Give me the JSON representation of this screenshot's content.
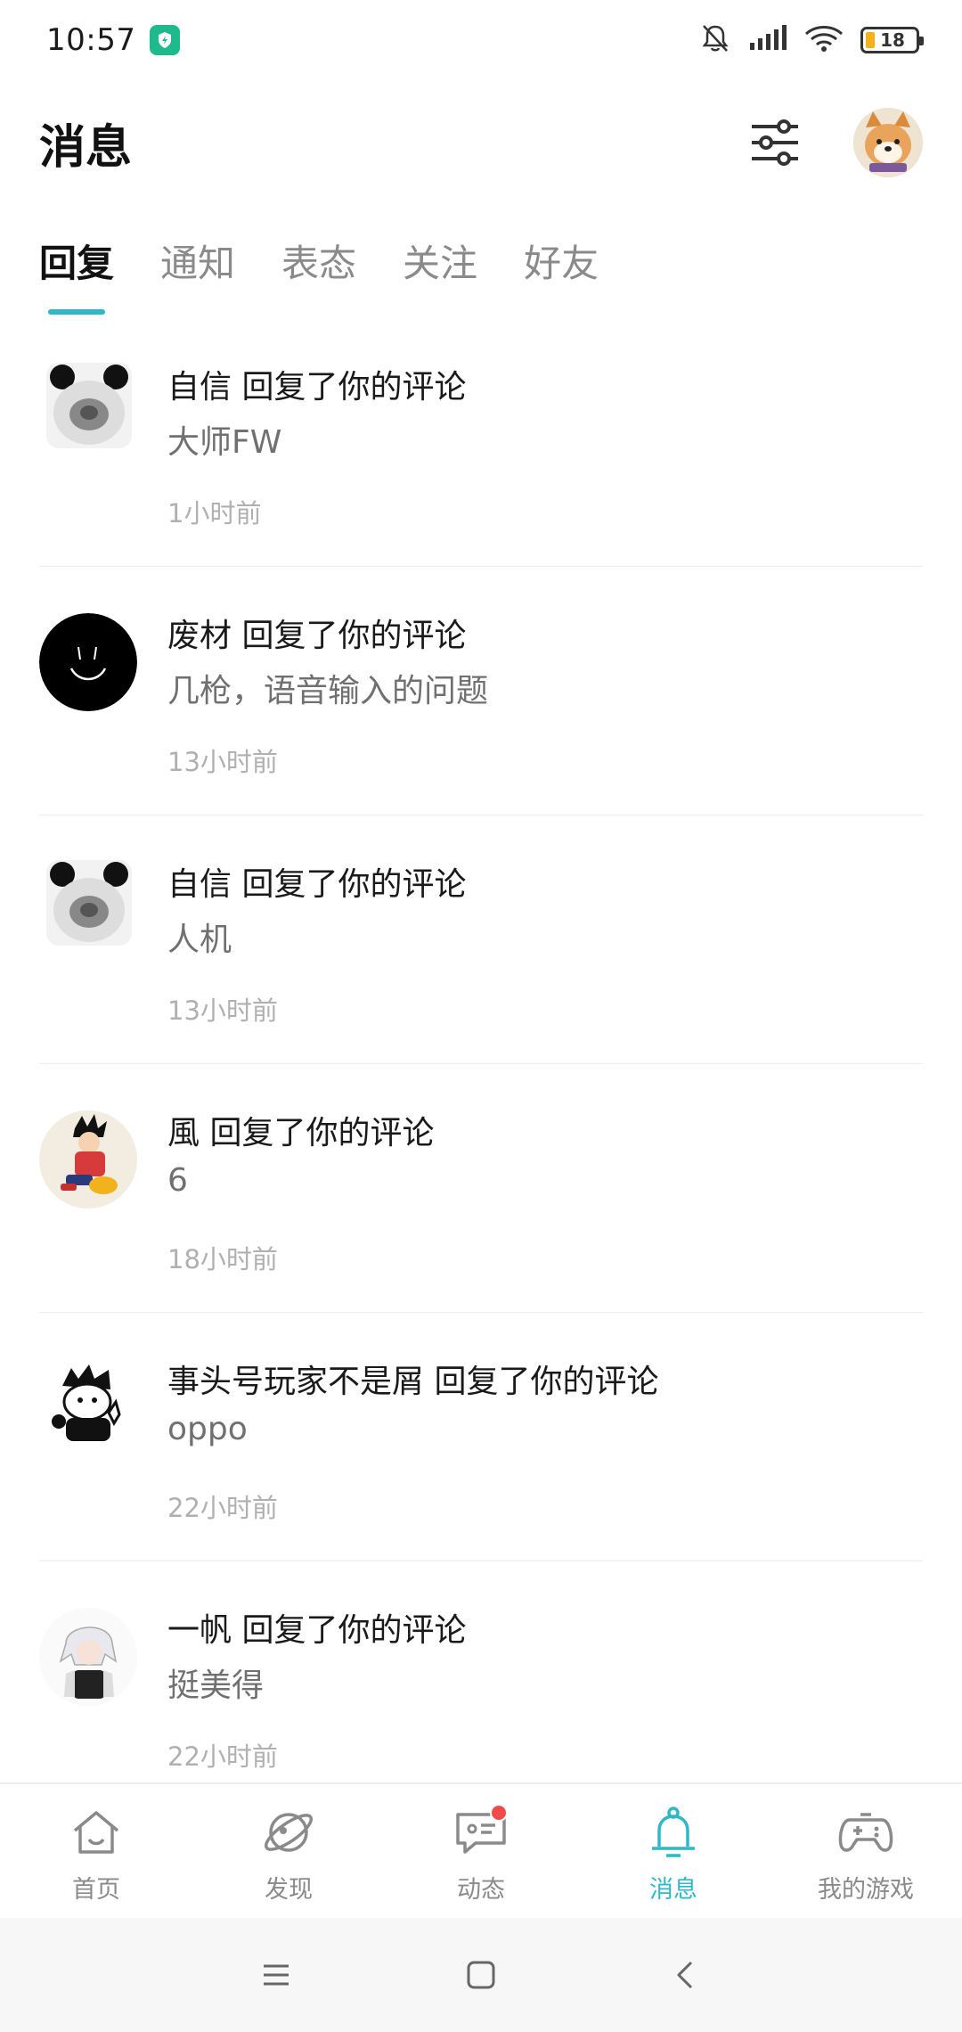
{
  "status_bar": {
    "time": "10:57",
    "battery": "18",
    "icons": [
      "app-badge-icon",
      "mute-bell-icon",
      "signal-icon",
      "wifi-icon",
      "battery-icon"
    ]
  },
  "header": {
    "title": "消息",
    "filter_icon": "filter-sliders-icon",
    "avatar": "user-avatar"
  },
  "tabs": [
    {
      "label": "回复",
      "active": true
    },
    {
      "label": "通知",
      "active": false
    },
    {
      "label": "表态",
      "active": false
    },
    {
      "label": "关注",
      "active": false
    },
    {
      "label": "好友",
      "active": false
    }
  ],
  "messages": [
    {
      "name": "自信",
      "action": "回复了你的评论",
      "title": "自信 回复了你的评论",
      "content": "大师FW",
      "time": "1小时前"
    },
    {
      "name": "废材",
      "action": "回复了你的评论",
      "title": "废材 回复了你的评论",
      "content": "几枪，语音输入的问题",
      "time": "13小时前"
    },
    {
      "name": "自信",
      "action": "回复了你的评论",
      "title": "自信 回复了你的评论",
      "content": "人机",
      "time": "13小时前"
    },
    {
      "name": "風",
      "action": "回复了你的评论",
      "title": "風 回复了你的评论",
      "content": "6",
      "time": "18小时前"
    },
    {
      "name": "事头号玩家不是屑",
      "action": "回复了你的评论",
      "title": "事头号玩家不是屑 回复了你的评论",
      "content": "oppo",
      "time": "22小时前"
    },
    {
      "name": "一帆",
      "action": "回复了你的评论",
      "title": "一帆 回复了你的评论",
      "content": "挺美得",
      "time": "22小时前"
    }
  ],
  "bottom_nav": [
    {
      "label": "首页",
      "icon": "home-icon",
      "active": false
    },
    {
      "label": "发现",
      "icon": "planet-icon",
      "active": false
    },
    {
      "label": "动态",
      "icon": "chat-bubble-icon",
      "active": false,
      "badge": true
    },
    {
      "label": "消息",
      "icon": "bell-icon",
      "active": true
    },
    {
      "label": "我的游戏",
      "icon": "gamepad-icon",
      "active": false
    }
  ],
  "system_nav": [
    "menu-icon",
    "home-square-icon",
    "back-icon"
  ],
  "colors": {
    "accent": "#2fb8c6",
    "badge": "#f04a4a",
    "app_badge": "#1fb98e"
  }
}
